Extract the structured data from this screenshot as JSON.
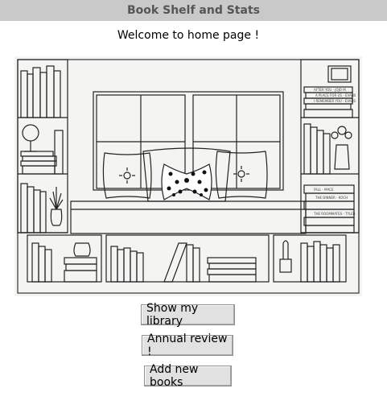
{
  "window": {
    "title": "Book Shelf and Stats"
  },
  "main": {
    "welcome_text": "Welcome to home page !"
  },
  "buttons": {
    "show_library": "Show my library",
    "annual_review": "Annual review !",
    "add_books": "Add new books"
  },
  "illustration": {
    "icon": "bookshelf-window-seat-drawing",
    "book_spines": [
      "AFTER YOU - JOJO M.",
      "A PLACE FOR US - EVANS",
      "I REMEMBER YOU - EVANS",
      "FALL - MACE",
      "THE DINNER - KOCH",
      "THE ROOMMATES - TYLER"
    ]
  }
}
